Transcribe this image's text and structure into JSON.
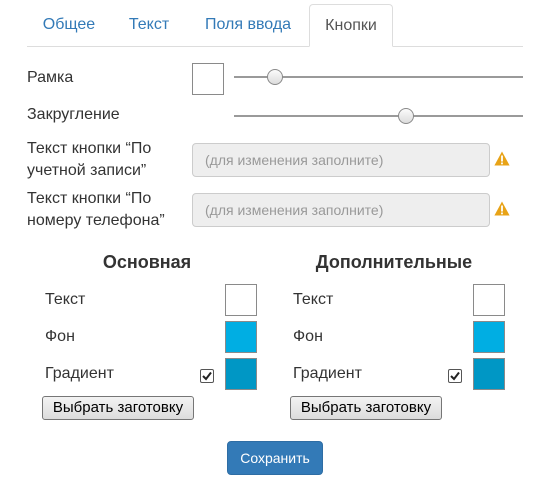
{
  "tabs": [
    {
      "label": "Общее"
    },
    {
      "label": "Текст"
    },
    {
      "label": "Поля ввода"
    },
    {
      "label": "Кнопки"
    }
  ],
  "active_tab": "Кнопки",
  "border": {
    "label": "Рамка",
    "level": 0.12
  },
  "rounding": {
    "label": "Закругление",
    "level": 0.6
  },
  "account_button_text": {
    "label_line1": "Текст кнопки “По",
    "label_line2": "учетной записи”",
    "placeholder": "(для изменения заполните)",
    "warning_icon": "warning-triangle-icon"
  },
  "phone_button_text": {
    "label_line1": "Текст кнопки “По",
    "label_line2": "номеру телефона”",
    "placeholder": "(для изменения заполните)",
    "warning_icon": "warning-triangle-icon"
  },
  "primary": {
    "title": "Основная",
    "text_label": "Текст",
    "bg_label": "Фон",
    "gradient_label": "Градиент",
    "gradient_checked": true,
    "preset_button": "Выбрать заготовку",
    "text_color": "#ffffff",
    "bg_color": "#00aee3",
    "gradient_color": "#0097c5"
  },
  "secondary": {
    "title": "Дополнительные",
    "text_label": "Текст",
    "bg_label": "Фон",
    "gradient_label": "Градиент",
    "gradient_checked": true,
    "preset_button": "Выбрать заготовку",
    "text_color": "#ffffff",
    "bg_color": "#00aee3",
    "gradient_color": "#0097c5"
  },
  "save_button": "Сохранить",
  "colors": {
    "accent": "#337ab7",
    "warning": "#e8a317"
  }
}
